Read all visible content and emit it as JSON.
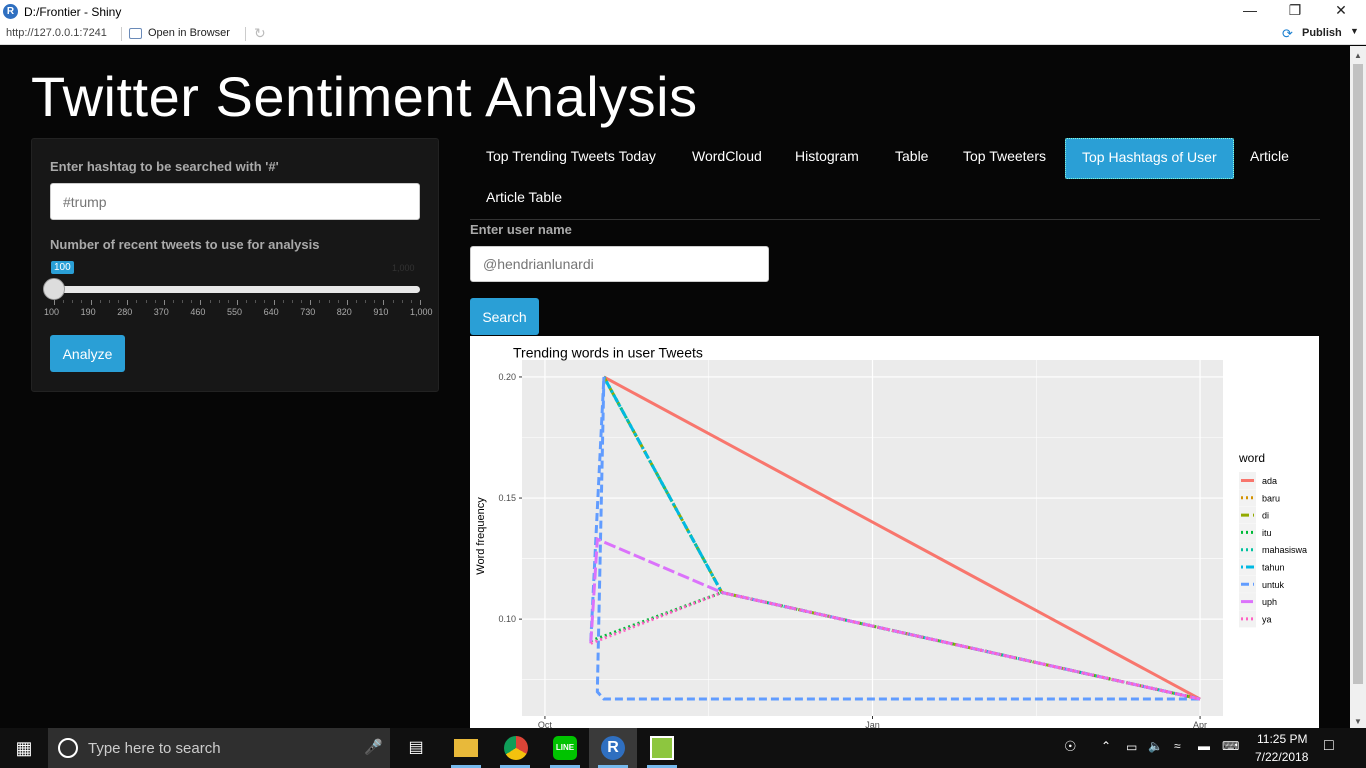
{
  "window": {
    "title": "D:/Frontier - Shiny",
    "r_logo": "R"
  },
  "addressbar": {
    "url": "http://127.0.0.1:7241",
    "open_browser": "Open in Browser",
    "publish": "Publish"
  },
  "app": {
    "title": "Twitter Sentiment Analysis"
  },
  "sidebar": {
    "hashtag_label": "Enter hashtag to be searched with '#'",
    "hashtag_placeholder": "#trump",
    "count_label": "Number of recent tweets to use for analysis",
    "slider_value": "100",
    "slider_min": 100,
    "slider_max": 1000,
    "slider_max_label": "1,000",
    "slider_ticks": [
      "100",
      "190",
      "280",
      "370",
      "460",
      "550",
      "640",
      "730",
      "820",
      "910",
      "1,000"
    ],
    "analyze_label": "Analyze"
  },
  "tabs": [
    {
      "label": "Top Trending Tweets Today"
    },
    {
      "label": "WordCloud"
    },
    {
      "label": "Histogram"
    },
    {
      "label": "Table"
    },
    {
      "label": "Top Tweeters"
    },
    {
      "label": "Top Hashtags of User",
      "active": true
    },
    {
      "label": "Article"
    },
    {
      "label": "Article Table"
    }
  ],
  "user": {
    "label": "Enter user name",
    "placeholder": "@hendrianlunardi",
    "search_label": "Search"
  },
  "chart_data": {
    "type": "line",
    "title": "Trending words in user Tweets",
    "xlabel": "",
    "ylabel": "Word frequency",
    "x_ticks": [
      "Oct",
      "Jan",
      "Apr"
    ],
    "y_ticks": [
      "0.10",
      "0.15",
      "0.20"
    ],
    "ylim": [
      0.06,
      0.207
    ],
    "legend_title": "word",
    "legend_position": "right",
    "grid": true,
    "series": [
      {
        "name": "ada",
        "color": "#F8766D",
        "dash": "solid",
        "x": [
          0.09,
          1.0
        ],
        "y": [
          0.2,
          0.067
        ]
      },
      {
        "name": "baru",
        "color": "#D39200",
        "dash": "dotted",
        "x": [
          0.09,
          0.27,
          1.0
        ],
        "y": [
          0.2,
          0.111,
          0.067
        ]
      },
      {
        "name": "di",
        "color": "#93AA00",
        "dash": "dashed",
        "x": [
          0.09,
          0.27,
          1.0
        ],
        "y": [
          0.2,
          0.111,
          0.067
        ]
      },
      {
        "name": "itu",
        "color": "#00BA38",
        "dash": "dotted",
        "x": [
          0.07,
          0.27,
          1.0
        ],
        "y": [
          0.091,
          0.111,
          0.067
        ]
      },
      {
        "name": "mahasiswa",
        "color": "#00C19F",
        "dash": "dotted",
        "x": [
          0.09,
          0.27,
          1.0
        ],
        "y": [
          0.2,
          0.111,
          0.067
        ]
      },
      {
        "name": "tahun",
        "color": "#00B9E3",
        "dash": "dotdash",
        "x": [
          0.09,
          0.27,
          1.0
        ],
        "y": [
          0.2,
          0.111,
          0.067
        ]
      },
      {
        "name": "untuk",
        "color": "#619CFF",
        "dash": "dashed",
        "x": [
          0.07,
          0.09,
          0.08,
          0.09,
          1.0
        ],
        "y": [
          0.091,
          0.2,
          0.07,
          0.067,
          0.067
        ]
      },
      {
        "name": "uph",
        "color": "#DB72FB",
        "dash": "longdash",
        "x": [
          0.07,
          0.08,
          0.27,
          1.0
        ],
        "y": [
          0.09,
          0.133,
          0.111,
          0.067
        ]
      },
      {
        "name": "ya",
        "color": "#FF61C3",
        "dash": "dotted",
        "x": [
          0.07,
          0.27,
          1.0
        ],
        "y": [
          0.09,
          0.111,
          0.067
        ]
      }
    ]
  },
  "taskbar": {
    "search_placeholder": "Type here to search",
    "time": "11:25 PM",
    "date": "7/22/2018",
    "apps": [
      "task-view-icon",
      "file-explorer-icon",
      "chrome-icon",
      "line-icon",
      "r-icon",
      "notepad-icon"
    ]
  }
}
